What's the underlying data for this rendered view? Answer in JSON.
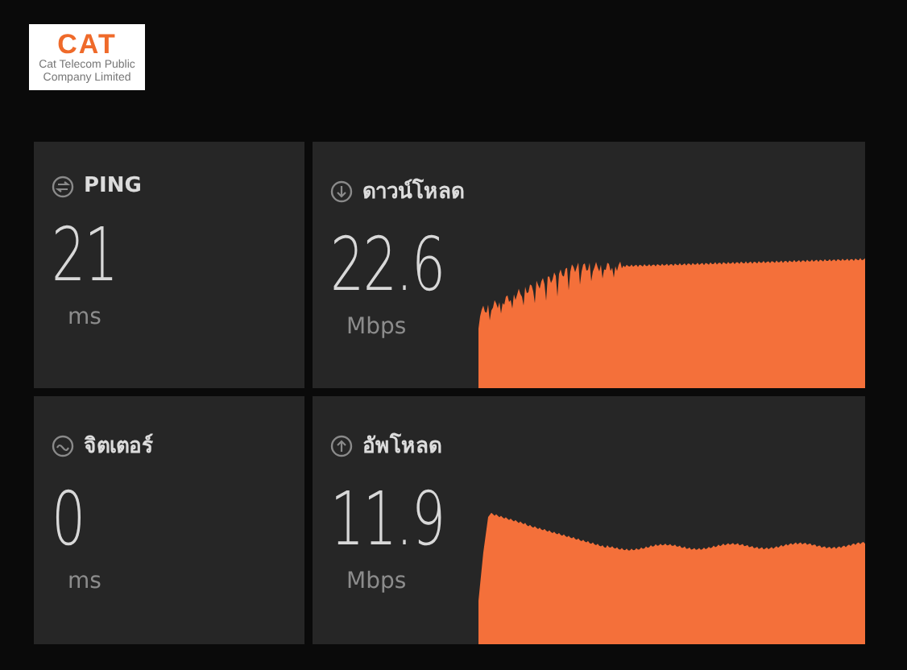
{
  "logo": {
    "title": "CAT",
    "subtitle": "Cat Telecom Public Company Limited"
  },
  "cards": [
    {
      "kind": "ping",
      "label": "PING",
      "value": "21",
      "unit": "ms"
    },
    {
      "kind": "download",
      "label": "ดาวน์โหลด",
      "value": "22.6",
      "unit": "Mbps"
    },
    {
      "kind": "jitter",
      "label": "จิตเตอร์",
      "value": "0",
      "unit": "ms"
    },
    {
      "kind": "upload",
      "label": "อัพโหลด",
      "value": "11.9",
      "unit": "Mbps"
    }
  ]
}
